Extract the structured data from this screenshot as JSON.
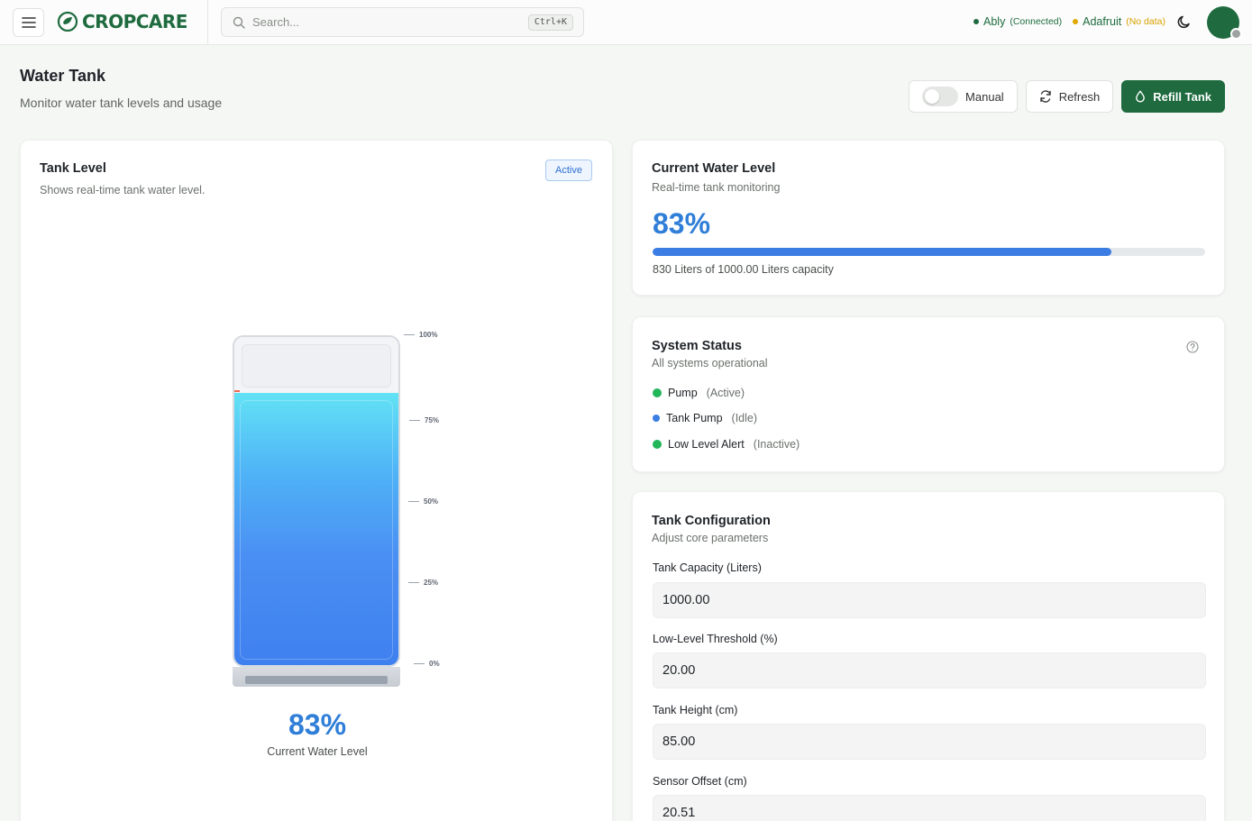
{
  "header": {
    "brand": "CROPCARE",
    "search_placeholder": "Search...",
    "shortcut": "Ctrl+K",
    "ably_label": "Ably",
    "ably_status": "(Connected)",
    "adafruit_label": "Adafruit",
    "adafruit_status": "(No data)"
  },
  "page": {
    "title": "Water Tank",
    "subtitle": "Monitor water tank levels and usage"
  },
  "actions": {
    "manual_label": "Manual",
    "manual_on": false,
    "refresh_label": "Refresh",
    "refill_label": "Refill Tank"
  },
  "tank_card": {
    "title": "Tank Level",
    "subtitle": "Shows real-time tank water level.",
    "badge": "Active",
    "level_percent": 83,
    "level_text": "83%",
    "caption": "Current Water Level",
    "ticks": [
      "100%",
      "75%",
      "50%",
      "25%",
      "0%"
    ]
  },
  "level_card": {
    "title": "Current Water Level",
    "subtitle": "Real-time tank monitoring",
    "percent_text": "83%",
    "percent": 83,
    "note": "830 Liters of 1000.00 Liters capacity"
  },
  "status_card": {
    "title": "System Status",
    "subtitle": "All systems operational",
    "items": [
      {
        "name": "Pump",
        "state": "(Active)",
        "color": "#22b65a"
      },
      {
        "name": "Tank Pump",
        "state": "(Idle)",
        "color": "#3b7de3"
      },
      {
        "name": "Low Level Alert",
        "state": "(Inactive)",
        "color": "#22b65a"
      }
    ]
  },
  "config_card": {
    "title": "Tank Configuration",
    "subtitle": "Adjust core parameters",
    "fields": [
      {
        "label": "Tank Capacity (Liters)",
        "value": "1000.00"
      },
      {
        "label": "Low-Level Threshold (%)",
        "value": "20.00"
      },
      {
        "label": "Tank Height (cm)",
        "value": "85.00"
      },
      {
        "label": "Sensor Offset (cm)",
        "value": "20.51"
      }
    ]
  },
  "colors": {
    "brand": "#1f6b3f",
    "accent_blue": "#2f7ed8",
    "connected": "#1f6b3f",
    "no_data": "#d9a100"
  }
}
